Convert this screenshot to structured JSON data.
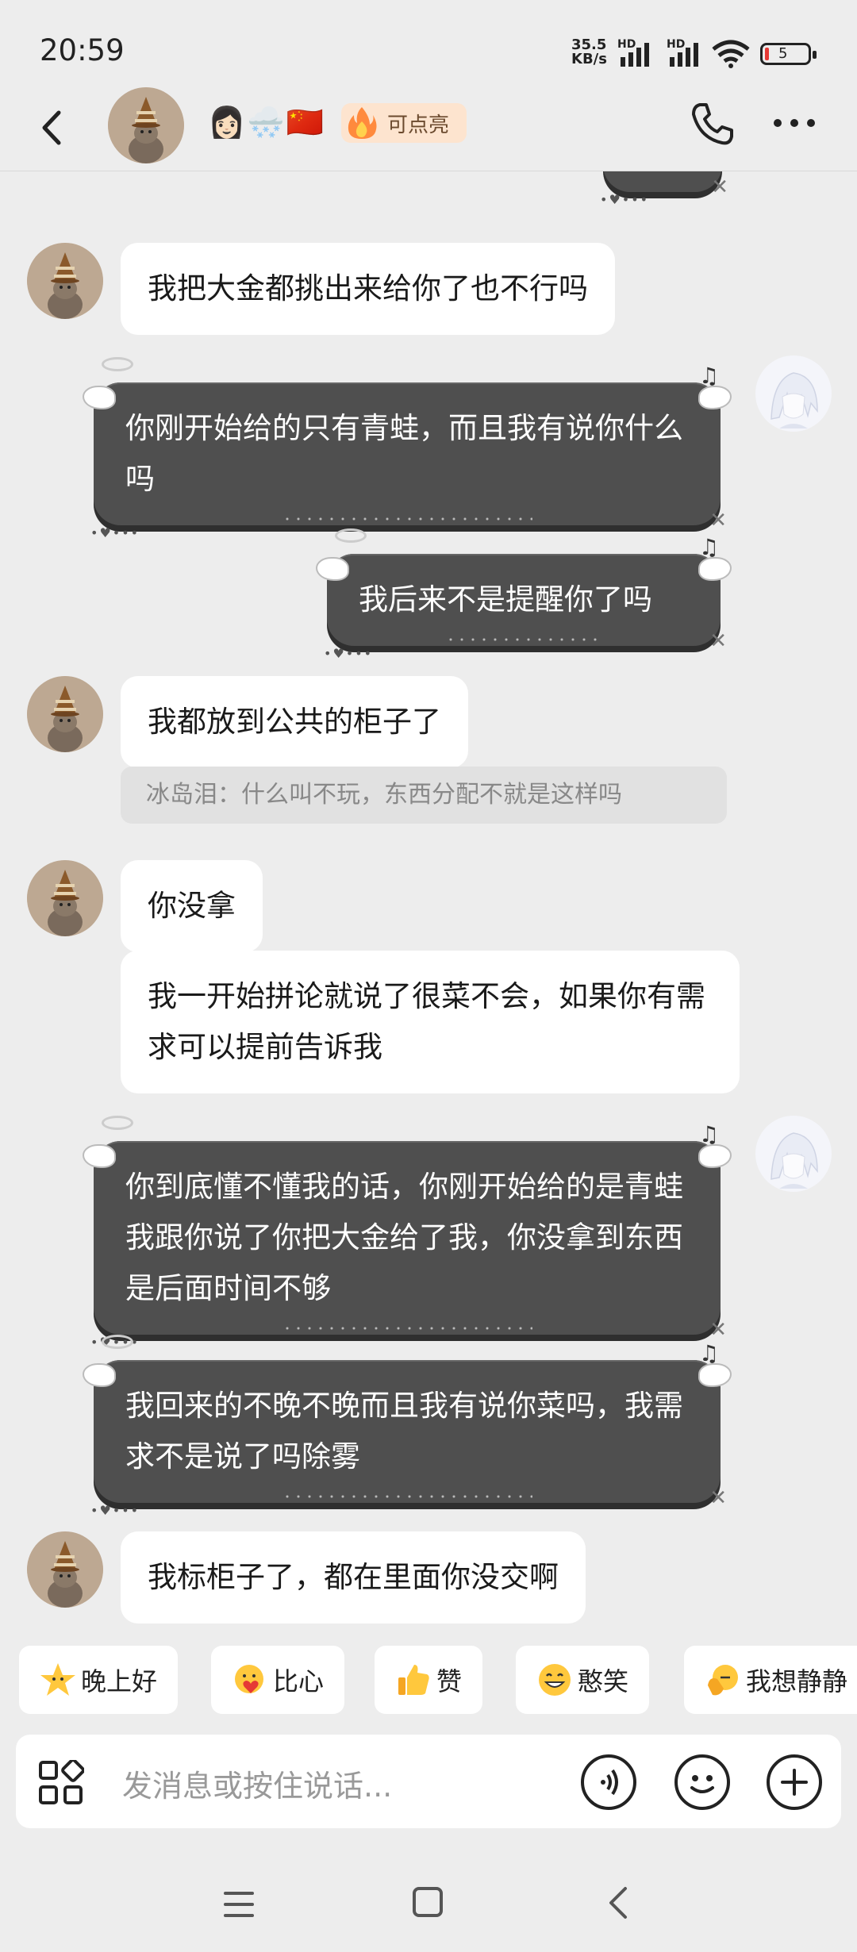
{
  "status_bar": {
    "time": "20:59",
    "net_speed_value": "35.5",
    "net_speed_unit": "KB/s",
    "sim1_label": "HD",
    "sim2_label": "HD",
    "battery": "5"
  },
  "header": {
    "contact_emoji": "👩🏻🌨️🇨🇳",
    "spark_label": "可点亮"
  },
  "messages": [
    {
      "side": "left",
      "text": "我把大金都挑出来给你了也不行吗"
    },
    {
      "side": "right",
      "text": "你刚开始给的只有青蛙，而且我有说你什么吗"
    },
    {
      "side": "right",
      "text": "我后来不是提醒你了吗"
    },
    {
      "side": "left",
      "text": "我都放到公共的柜子了"
    },
    {
      "side": "quote",
      "text": "冰岛泪：什么叫不玩，东西分配不就是这样吗"
    },
    {
      "side": "left",
      "text": "你没拿"
    },
    {
      "side": "left",
      "text": "我一开始拼论就说了很菜不会，如果你有需求可以提前告诉我"
    },
    {
      "side": "right",
      "text": "你到底懂不懂我的话，你刚开始给的是青蛙我跟你说了你把大金给了我，你没拿到东西是后面时间不够"
    },
    {
      "side": "right",
      "text": "我回来的不晚不晚而且我有说你菜吗，我需求不是说了吗除雾"
    },
    {
      "side": "left",
      "text": "我标柜子了，都在里面你没交啊"
    }
  ],
  "quick_replies": [
    {
      "icon": "star-face-icon",
      "label": "晚上好"
    },
    {
      "icon": "heart-face-icon",
      "label": "比心"
    },
    {
      "icon": "thumbs-up-icon",
      "label": "赞"
    },
    {
      "icon": "grin-icon",
      "label": "憨笑"
    },
    {
      "icon": "calm-hand-icon",
      "label": "我想静静"
    }
  ],
  "input": {
    "placeholder": "发消息或按住说话..."
  },
  "colors": {
    "background": "#ededed",
    "dark_bubble": "#4f4f4f",
    "white_bubble": "#ffffff",
    "spark_badge": "#fde4cf"
  }
}
